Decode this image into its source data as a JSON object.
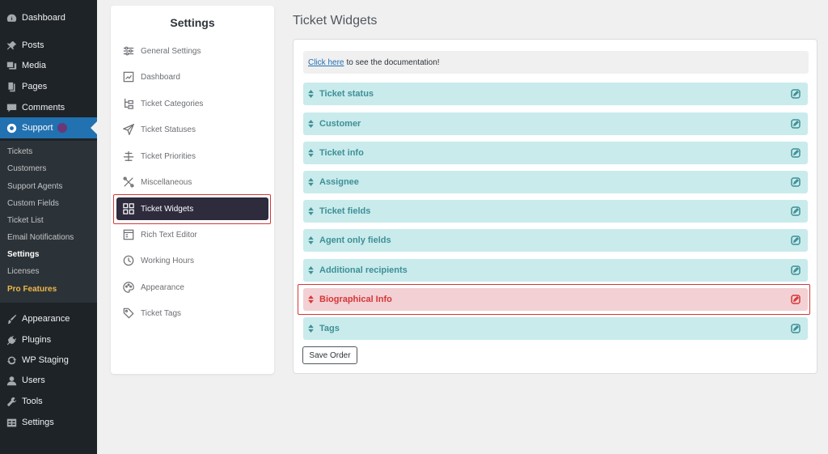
{
  "wp_menu": {
    "items": [
      {
        "label": "Dashboard",
        "icon": "dashboard-icon"
      },
      {
        "label": "Posts",
        "icon": "pin-icon"
      },
      {
        "label": "Media",
        "icon": "media-icon"
      },
      {
        "label": "Pages",
        "icon": "pages-icon"
      },
      {
        "label": "Comments",
        "icon": "comment-icon"
      },
      {
        "label": "Support",
        "icon": "lifebuoy-icon"
      },
      {
        "label": "Appearance",
        "icon": "brush-icon"
      },
      {
        "label": "Plugins",
        "icon": "plug-icon"
      },
      {
        "label": "WP Staging",
        "icon": "refresh-icon"
      },
      {
        "label": "Users",
        "icon": "user-icon"
      },
      {
        "label": "Tools",
        "icon": "wrench-icon"
      },
      {
        "label": "Settings",
        "icon": "settings-icon"
      }
    ],
    "submenu": [
      "Tickets",
      "Customers",
      "Support Agents",
      "Custom Fields",
      "Ticket List",
      "Email Notifications",
      "Settings",
      "Licenses",
      "Pro Features"
    ]
  },
  "settings": {
    "title": "Settings",
    "items": [
      {
        "label": "General Settings",
        "icon": "sliders-icon"
      },
      {
        "label": "Dashboard",
        "icon": "chart-icon"
      },
      {
        "label": "Ticket Categories",
        "icon": "hierarchy-icon"
      },
      {
        "label": "Ticket Statuses",
        "icon": "send-icon"
      },
      {
        "label": "Ticket Priorities",
        "icon": "priority-icon"
      },
      {
        "label": "Miscellaneous",
        "icon": "tools-icon"
      },
      {
        "label": "Ticket Widgets",
        "icon": "grid-icon"
      },
      {
        "label": "Rich Text Editor",
        "icon": "editor-icon"
      },
      {
        "label": "Working Hours",
        "icon": "clock-icon"
      },
      {
        "label": "Appearance",
        "icon": "palette-icon"
      },
      {
        "label": "Ticket Tags",
        "icon": "tag-icon"
      }
    ]
  },
  "main": {
    "title": "Ticket Widgets",
    "doc_link": "Click here",
    "doc_text": "to see the documentation!",
    "widgets": [
      "Ticket status",
      "Customer",
      "Ticket info",
      "Assignee",
      "Ticket fields",
      "Agent only fields",
      "Additional recipients",
      "Biographical Info",
      "Tags"
    ],
    "save_label": "Save Order"
  },
  "colors": {
    "sidebar_bg": "#1d2327",
    "wp_active": "#2271b1",
    "settings_active": "#2e2b3d",
    "widget_bg": "#c9ebec",
    "widget_text": "#3f8f96",
    "highlight_bg": "#f2d0d3",
    "highlight_red": "#d63638",
    "pro_features": "#f0b849"
  }
}
